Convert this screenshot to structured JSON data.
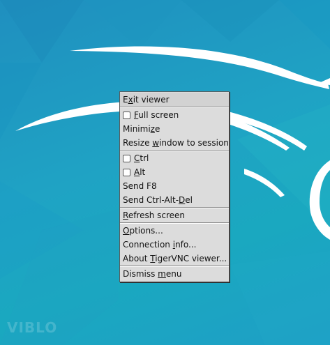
{
  "watermark": "VIBLO",
  "menu": {
    "exit_viewer": {
      "pre": "E",
      "ul": "x",
      "post": "it viewer"
    },
    "full_screen": {
      "pre": "",
      "ul": "F",
      "post": "ull screen",
      "checked": false
    },
    "minimize": {
      "pre": "Minimi",
      "ul": "z",
      "post": "e"
    },
    "resize_window": {
      "pre": "Resize ",
      "ul": "w",
      "post": "indow to session"
    },
    "ctrl": {
      "pre": "",
      "ul": "C",
      "post": "trl",
      "checked": false
    },
    "alt": {
      "pre": "",
      "ul": "A",
      "post": "lt",
      "checked": false
    },
    "send_f8": {
      "label": "Send F8"
    },
    "send_cad": {
      "pre": "Send Ctrl-Alt-",
      "ul": "D",
      "post": "el"
    },
    "refresh_screen": {
      "pre": "",
      "ul": "R",
      "post": "efresh screen"
    },
    "options": {
      "pre": "",
      "ul": "O",
      "post": "ptions..."
    },
    "connection_info": {
      "pre": "Connection ",
      "ul": "i",
      "post": "nfo..."
    },
    "about": {
      "pre": "About ",
      "ul": "T",
      "post": "igerVNC viewer..."
    },
    "dismiss_menu": {
      "pre": "Dismiss ",
      "ul": "m",
      "post": "enu"
    }
  },
  "colors": {
    "desktop_bg": "#1fa3c4",
    "menu_bg": "#dcdcdc"
  }
}
